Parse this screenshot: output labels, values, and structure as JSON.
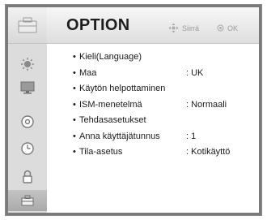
{
  "header": {
    "title": "OPTION",
    "move_label": "Siirrä",
    "ok_label": "OK"
  },
  "sidebar": {
    "items": [
      {
        "icon": "picture-icon"
      },
      {
        "icon": "screen-icon"
      },
      {
        "icon": "disc-icon"
      },
      {
        "icon": "clock-icon"
      },
      {
        "icon": "lock-icon"
      },
      {
        "icon": "option-toolbox-icon",
        "active": true
      }
    ]
  },
  "menu": {
    "items": [
      {
        "label": "Kieli(Language)",
        "value": ""
      },
      {
        "label": "Maa",
        "value": ": UK"
      },
      {
        "label": "Käytön helpottaminen",
        "value": ""
      },
      {
        "label": "ISM-menetelmä",
        "value": ": Normaali"
      },
      {
        "label": "Tehdasasetukset",
        "value": ""
      },
      {
        "label": "Anna käyttäjätunnus",
        "value": ": 1"
      },
      {
        "label": "Tila-asetus",
        "value": ": Kotikäyttö"
      }
    ]
  }
}
